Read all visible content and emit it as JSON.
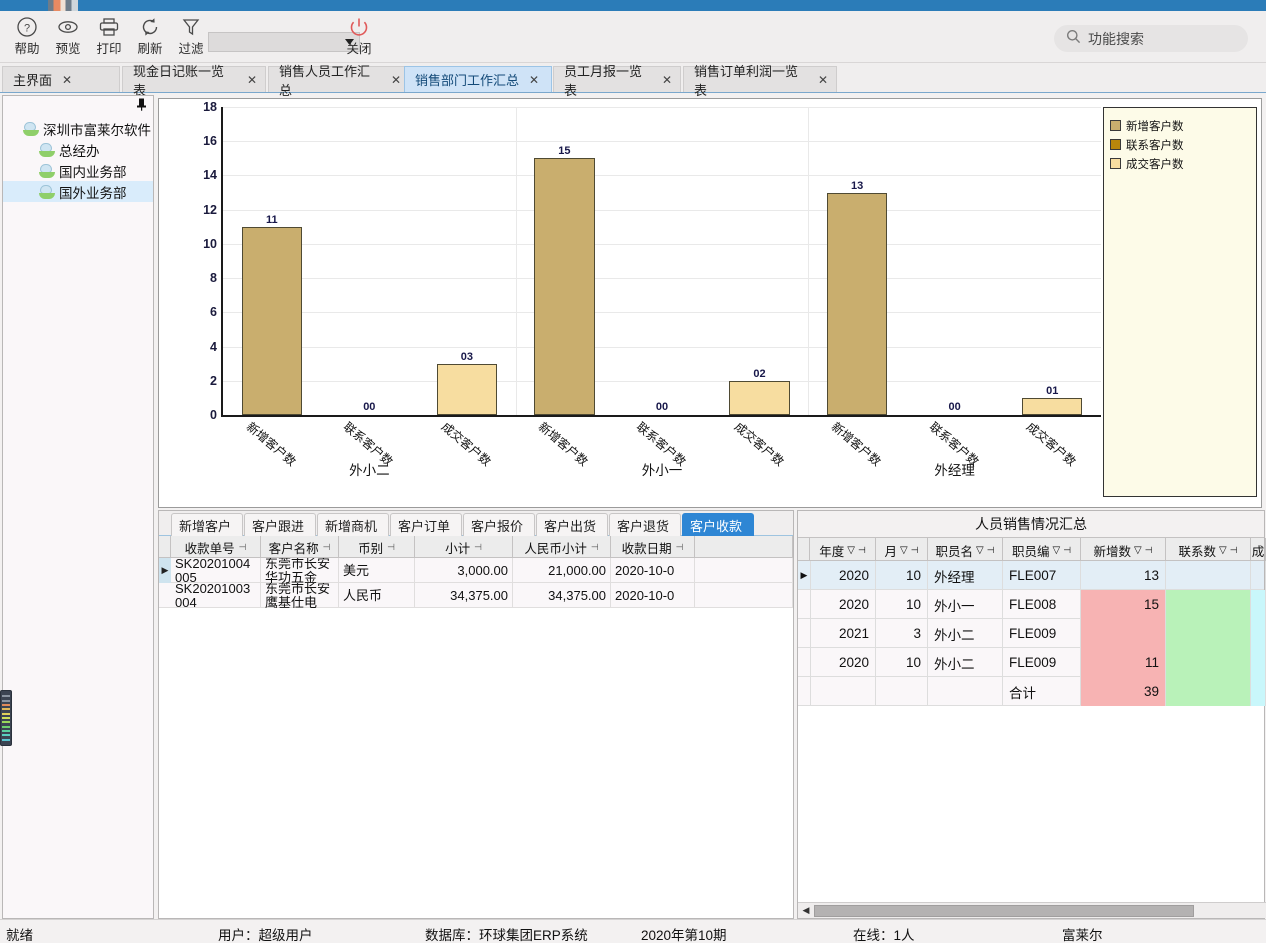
{
  "window": {
    "logo_name": "app-logo"
  },
  "toolbar": {
    "buttons": [
      {
        "label": "帮助",
        "icon": "question-circle-icon"
      },
      {
        "label": "预览",
        "icon": "eye-icon"
      },
      {
        "label": "打印",
        "icon": "printer-icon"
      },
      {
        "label": "刷新",
        "icon": "refresh-icon"
      },
      {
        "label": "过滤",
        "icon": "funnel-icon"
      },
      {
        "label": "关闭",
        "icon": "power-icon"
      }
    ],
    "combo_value": "",
    "search_icon": "search-icon",
    "dropdown_icon": "chevron-down-icon"
  },
  "func_search": {
    "placeholder": "功能搜索",
    "icon": "search-icon"
  },
  "tabs": [
    {
      "label": "主界面",
      "active": false
    },
    {
      "label": "现金日记账一览表",
      "active": false
    },
    {
      "label": "销售人员工作汇总",
      "active": false
    },
    {
      "label": "销售部门工作汇总",
      "active": true
    },
    {
      "label": "员工月报一览表",
      "active": false
    },
    {
      "label": "销售订单利润一览表",
      "active": false
    }
  ],
  "tab_close_icon": "✕",
  "tree": {
    "pin_icon": "pin-icon",
    "root": {
      "label": "深圳市富莱尔软件",
      "icon": "department-icon"
    },
    "children": [
      {
        "label": "总经办",
        "icon": "department-icon",
        "selected": false
      },
      {
        "label": "国内业务部",
        "icon": "department-icon",
        "selected": false
      },
      {
        "label": "国外业务部",
        "icon": "department-icon",
        "selected": true
      }
    ]
  },
  "chart_data": {
    "type": "bar",
    "title": "",
    "xlabel": "",
    "ylabel": "",
    "ylim": [
      0,
      18
    ],
    "yticks": [
      0,
      2,
      4,
      6,
      8,
      10,
      12,
      14,
      16,
      18
    ],
    "grid": true,
    "legend_position": "right",
    "groups": [
      "外小二",
      "外小一",
      "外经理"
    ],
    "categories": [
      "新增客户数",
      "联系客户数",
      "成交客户数"
    ],
    "series": [
      {
        "name": "新增客户数",
        "color": "#c9ae6e",
        "values": [
          11,
          15,
          13
        ],
        "labels": [
          "11",
          "15",
          "13"
        ]
      },
      {
        "name": "联系客户数",
        "color": "#b8860b",
        "values": [
          0,
          0,
          0
        ],
        "labels": [
          "00",
          "00",
          "00"
        ]
      },
      {
        "name": "成交客户数",
        "color": "#f7dda0",
        "values": [
          3,
          2,
          1
        ],
        "labels": [
          "03",
          "02",
          "01"
        ]
      }
    ]
  },
  "left_grid": {
    "tabs": [
      {
        "label": "新增客户",
        "active": false
      },
      {
        "label": "客户跟进",
        "active": false
      },
      {
        "label": "新增商机",
        "active": false
      },
      {
        "label": "客户订单",
        "active": false
      },
      {
        "label": "客户报价",
        "active": false
      },
      {
        "label": "客户出货",
        "active": false
      },
      {
        "label": "客户退货",
        "active": false
      },
      {
        "label": "客户收款",
        "active": true
      }
    ],
    "columns": [
      "收款单号",
      "客户名称",
      "币别",
      "小计",
      "人民币小计",
      "收款日期"
    ],
    "rows": [
      {
        "current": true,
        "收款单号": "SK20201004005",
        "客户名称": "东莞市长安华功五金",
        "币别": "美元",
        "小计": "3,000.00",
        "人民币小计": "21,000.00",
        "收款日期": "2020-10-0"
      },
      {
        "current": false,
        "收款单号": "SK20201003004",
        "客户名称": "东莞市长安鹰基仕电",
        "币别": "人民币",
        "小计": "34,375.00",
        "人民币小计": "34,375.00",
        "收款日期": "2020-10-0"
      }
    ]
  },
  "right_grid": {
    "title": "人员销售情况汇总",
    "columns": [
      "年度",
      "月",
      "职员名",
      "职员编",
      "新增数",
      "联系数",
      "成"
    ],
    "rows": [
      {
        "current": true,
        "年度": "2020",
        "月": "10",
        "职员名": "外经理",
        "职员编": "FLE007",
        "新增数": "13",
        "联系数": "",
        "成": ""
      },
      {
        "current": false,
        "年度": "2020",
        "月": "10",
        "职员名": "外小一",
        "职员编": "FLE008",
        "新增数": "15",
        "联系数": "",
        "成": ""
      },
      {
        "current": false,
        "年度": "2021",
        "月": "3",
        "职员名": "外小二",
        "职员编": "FLE009",
        "新增数": "",
        "联系数": "",
        "成": ""
      },
      {
        "current": false,
        "年度": "2020",
        "月": "10",
        "职员名": "外小二",
        "职员编": "FLE009",
        "新增数": "11",
        "联系数": "",
        "成": ""
      },
      {
        "current": false,
        "年度": "",
        "月": "",
        "职员名": "",
        "职员编": "合计",
        "新增数": "39",
        "联系数": "",
        "成": ""
      }
    ],
    "filter_icon": "filter-icon",
    "pin_icon": "column-pin-icon"
  },
  "statusbar": {
    "ready": "就绪",
    "user": "用户：超级用户",
    "database": "数据库：环球集团ERP系统",
    "period": "2020年第10期",
    "online": "在线：1人",
    "brand": "富莱尔"
  }
}
